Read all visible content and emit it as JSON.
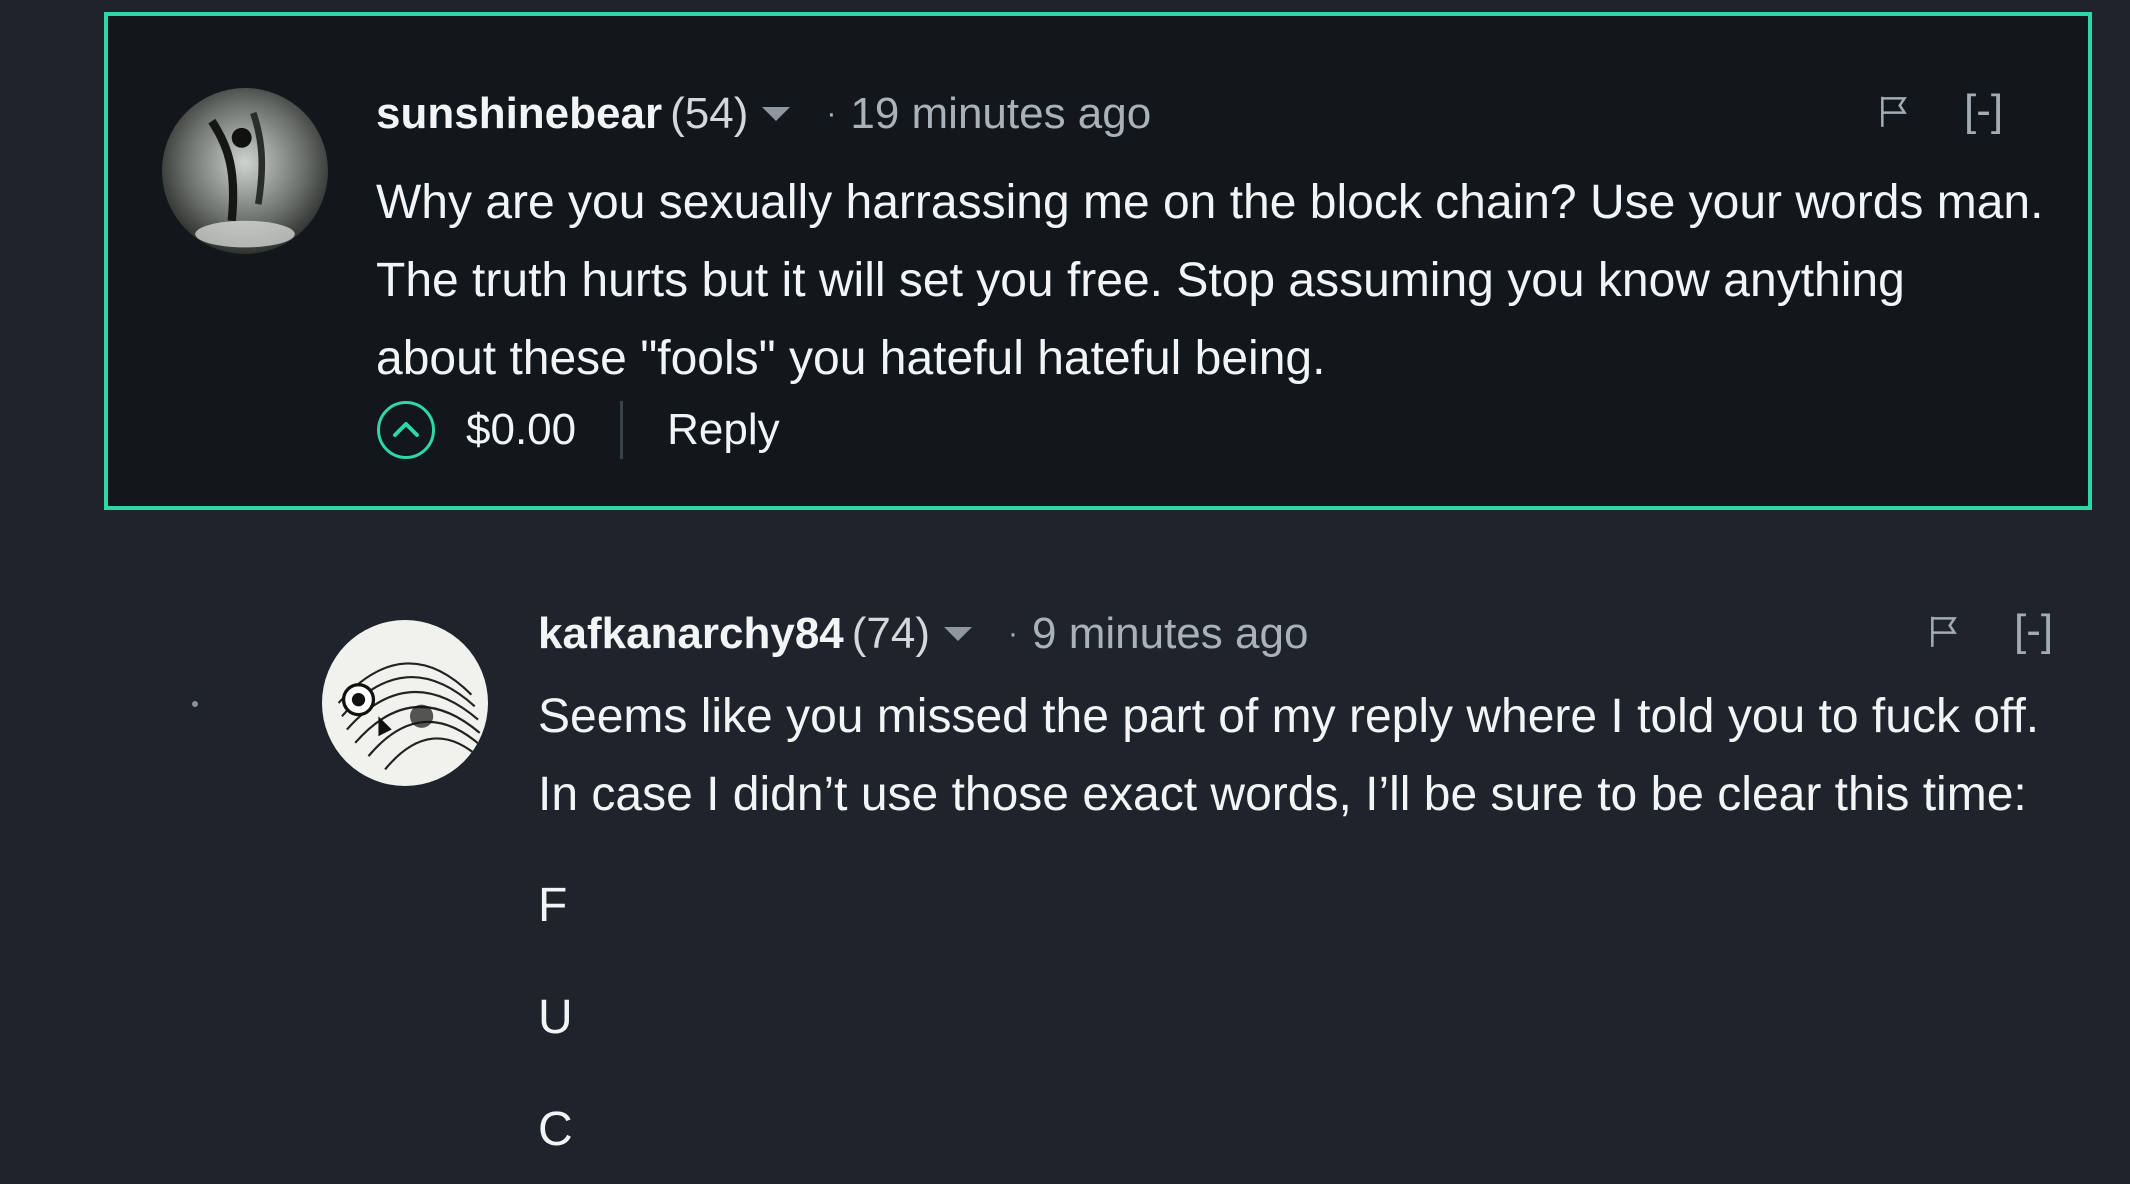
{
  "comments": [
    {
      "author": "sunshinebear",
      "reputation": "(54)",
      "time": "19 minutes ago",
      "collapse": "[-]",
      "body": [
        "Why are you sexually harrassing me on the block chain? Use your words man.",
        "The truth hurts but it will set you free. Stop assuming you know anything",
        "about these \"fools\" you hateful hateful being."
      ],
      "payout": "$0.00",
      "reply": "Reply"
    },
    {
      "author": "kafkanarchy84",
      "reputation": "(74)",
      "time": "9 minutes ago",
      "collapse": "[-]",
      "body": [
        "Seems like you missed the part of my reply where I told you to fuck off.",
        "In case I didn’t use those exact words, I’ll be sure to be clear this time:"
      ],
      "letters": [
        "F",
        "U",
        "C"
      ]
    }
  ],
  "separator": "·",
  "colors": {
    "accent": "#2fd6a6",
    "background": "#1f242c",
    "highlight_bg": "#12171c"
  }
}
